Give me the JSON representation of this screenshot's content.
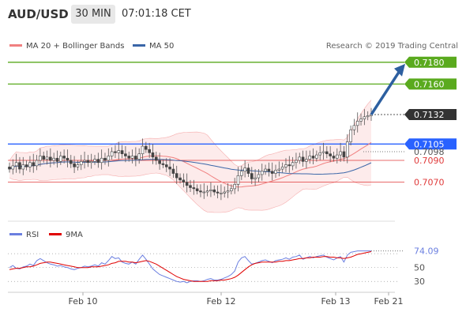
{
  "header": {
    "pair": "AUD/USD",
    "timeframe": "30 MIN",
    "time": "07:01:18 CET"
  },
  "legend": {
    "ma20": "MA 20 + Bollinger Bands",
    "ma50": "MA 50",
    "credit": "Research © 2019 Trading Central"
  },
  "rsi_legend": {
    "rsi": "RSI",
    "ma9": "9MA"
  },
  "colors": {
    "resistance": "#5aaa1e",
    "current": "#333333",
    "pivot": "#2962ff",
    "support": "#e03a3a",
    "ma20": "#f08080",
    "ma50": "#3a66a8",
    "candle": "#555555",
    "arrow": "#2d5fa0",
    "rsi": "#6b7fe0",
    "rsi_ma": "#e00000"
  },
  "chart_data": [
    {
      "type": "line",
      "subtype": "candlestick",
      "ylim": [
        0.704,
        0.719
      ],
      "x_ticks": [
        "Feb 10",
        "Feb 12",
        "Feb 13",
        "Feb 21"
      ],
      "levels": [
        {
          "value": 0.718,
          "label": "0.7180",
          "role": "resistance"
        },
        {
          "value": 0.716,
          "label": "0.7160",
          "role": "resistance"
        },
        {
          "value": 0.7132,
          "label": "0.7132",
          "role": "current"
        },
        {
          "value": 0.7105,
          "label": "0.7105",
          "role": "pivot"
        },
        {
          "value": 0.7098,
          "label": "0.7098",
          "role": "support"
        },
        {
          "value": 0.709,
          "label": "0.7090",
          "role": "support"
        },
        {
          "value": 0.707,
          "label": "0.7070",
          "role": "support"
        }
      ],
      "close": [
        0.7082,
        0.7085,
        0.7088,
        0.7082,
        0.7086,
        0.7084,
        0.7088,
        0.7085,
        0.709,
        0.7094,
        0.7091,
        0.7093,
        0.709,
        0.7092,
        0.7089,
        0.7094,
        0.7092,
        0.709,
        0.7087,
        0.7084,
        0.7086,
        0.7089,
        0.709,
        0.7088,
        0.7089,
        0.7091,
        0.7088,
        0.7092,
        0.709,
        0.7094,
        0.7098,
        0.7097,
        0.7099,
        0.7096,
        0.7094,
        0.7092,
        0.7094,
        0.7091,
        0.7096,
        0.7103,
        0.71,
        0.7097,
        0.7093,
        0.709,
        0.7087,
        0.7086,
        0.7084,
        0.7082,
        0.7078,
        0.7074,
        0.7072,
        0.707,
        0.7067,
        0.7065,
        0.7064,
        0.7062,
        0.7061,
        0.7061,
        0.7062,
        0.7063,
        0.7061,
        0.706,
        0.706,
        0.7061,
        0.7062,
        0.7064,
        0.7068,
        0.7076,
        0.708,
        0.7083,
        0.7078,
        0.7073,
        0.7074,
        0.7077,
        0.708,
        0.7082,
        0.708,
        0.7078,
        0.7081,
        0.7082,
        0.7084,
        0.7086,
        0.7085,
        0.7088,
        0.709,
        0.7093,
        0.7089,
        0.7091,
        0.7094,
        0.7092,
        0.7095,
        0.7097,
        0.7098,
        0.7096,
        0.7094,
        0.7092,
        0.7095,
        0.7098,
        0.7093,
        0.7107,
        0.7118,
        0.7122,
        0.7126,
        0.7128,
        0.713,
        0.7131,
        0.7132
      ],
      "rsi_ylim": [
        20,
        85
      ],
      "rsi_ticks": [
        30,
        50
      ],
      "rsi_current": {
        "value": 74.09,
        "label": "74.09"
      },
      "rsi": [
        50,
        53,
        49,
        48,
        51,
        52,
        55,
        53,
        60,
        63,
        60,
        57,
        55,
        54,
        52,
        53,
        51,
        50,
        48,
        47,
        49,
        50,
        52,
        51,
        52,
        54,
        52,
        57,
        55,
        60,
        66,
        63,
        64,
        58,
        56,
        55,
        58,
        55,
        62,
        68,
        62,
        55,
        48,
        44,
        40,
        38,
        36,
        34,
        32,
        30,
        29,
        30,
        28,
        30,
        31,
        31,
        30,
        31,
        33,
        34,
        32,
        32,
        33,
        35,
        37,
        40,
        45,
        58,
        64,
        66,
        60,
        55,
        56,
        58,
        60,
        61,
        59,
        57,
        60,
        61,
        62,
        64,
        62,
        65,
        66,
        68,
        62,
        64,
        66,
        64,
        66,
        67,
        68,
        65,
        63,
        61,
        64,
        66,
        58,
        68,
        72,
        73,
        74,
        74,
        74,
        74,
        74
      ],
      "rsi_ma": [
        47,
        48,
        49,
        49,
        50,
        51,
        51,
        52,
        54,
        56,
        57,
        58,
        58,
        57,
        56,
        55,
        54,
        53,
        52,
        51,
        50,
        50,
        50,
        50,
        51,
        51,
        51,
        52,
        53,
        54,
        56,
        57,
        59,
        59,
        59,
        58,
        58,
        57,
        58,
        59,
        60,
        59,
        57,
        55,
        52,
        49,
        46,
        43,
        40,
        37,
        35,
        33,
        32,
        31,
        30,
        30,
        30,
        30,
        30,
        31,
        31,
        31,
        32,
        32,
        33,
        34,
        36,
        39,
        43,
        47,
        51,
        54,
        56,
        57,
        58,
        58,
        58,
        58,
        58,
        59,
        59,
        60,
        60,
        61,
        62,
        63,
        63,
        64,
        64,
        65,
        65,
        65,
        66,
        66,
        65,
        65,
        64,
        64,
        63,
        64,
        65,
        67,
        69,
        70,
        71,
        72,
        73
      ]
    }
  ]
}
